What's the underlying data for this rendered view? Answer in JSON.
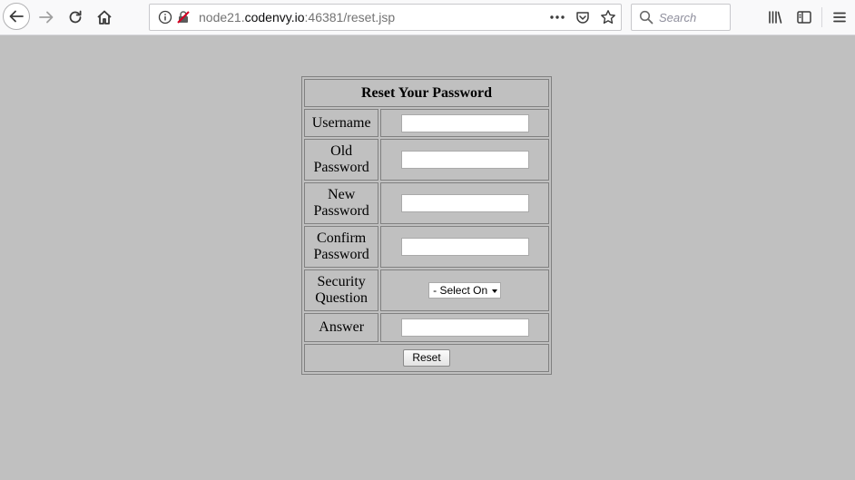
{
  "browser": {
    "url": {
      "host_prefix": "node21.",
      "host_main": "codenvy.io",
      "rest": ":46381/reset.jsp"
    },
    "search_placeholder": "Search"
  },
  "form": {
    "title": "Reset Your Password",
    "fields": {
      "username": {
        "label": "Username",
        "value": ""
      },
      "old_password": {
        "label_line1": "Old",
        "label_line2": "Password",
        "value": ""
      },
      "new_password": {
        "label_line1": "New",
        "label_line2": "Password",
        "value": ""
      },
      "confirm_password": {
        "label_line1": "Confirm",
        "label_line2": "Password",
        "value": ""
      },
      "security_question": {
        "label_line1": "Security",
        "label_line2": "Question",
        "selected": "- Select On"
      },
      "answer": {
        "label": "Answer",
        "value": ""
      }
    },
    "submit_label": "Reset"
  }
}
